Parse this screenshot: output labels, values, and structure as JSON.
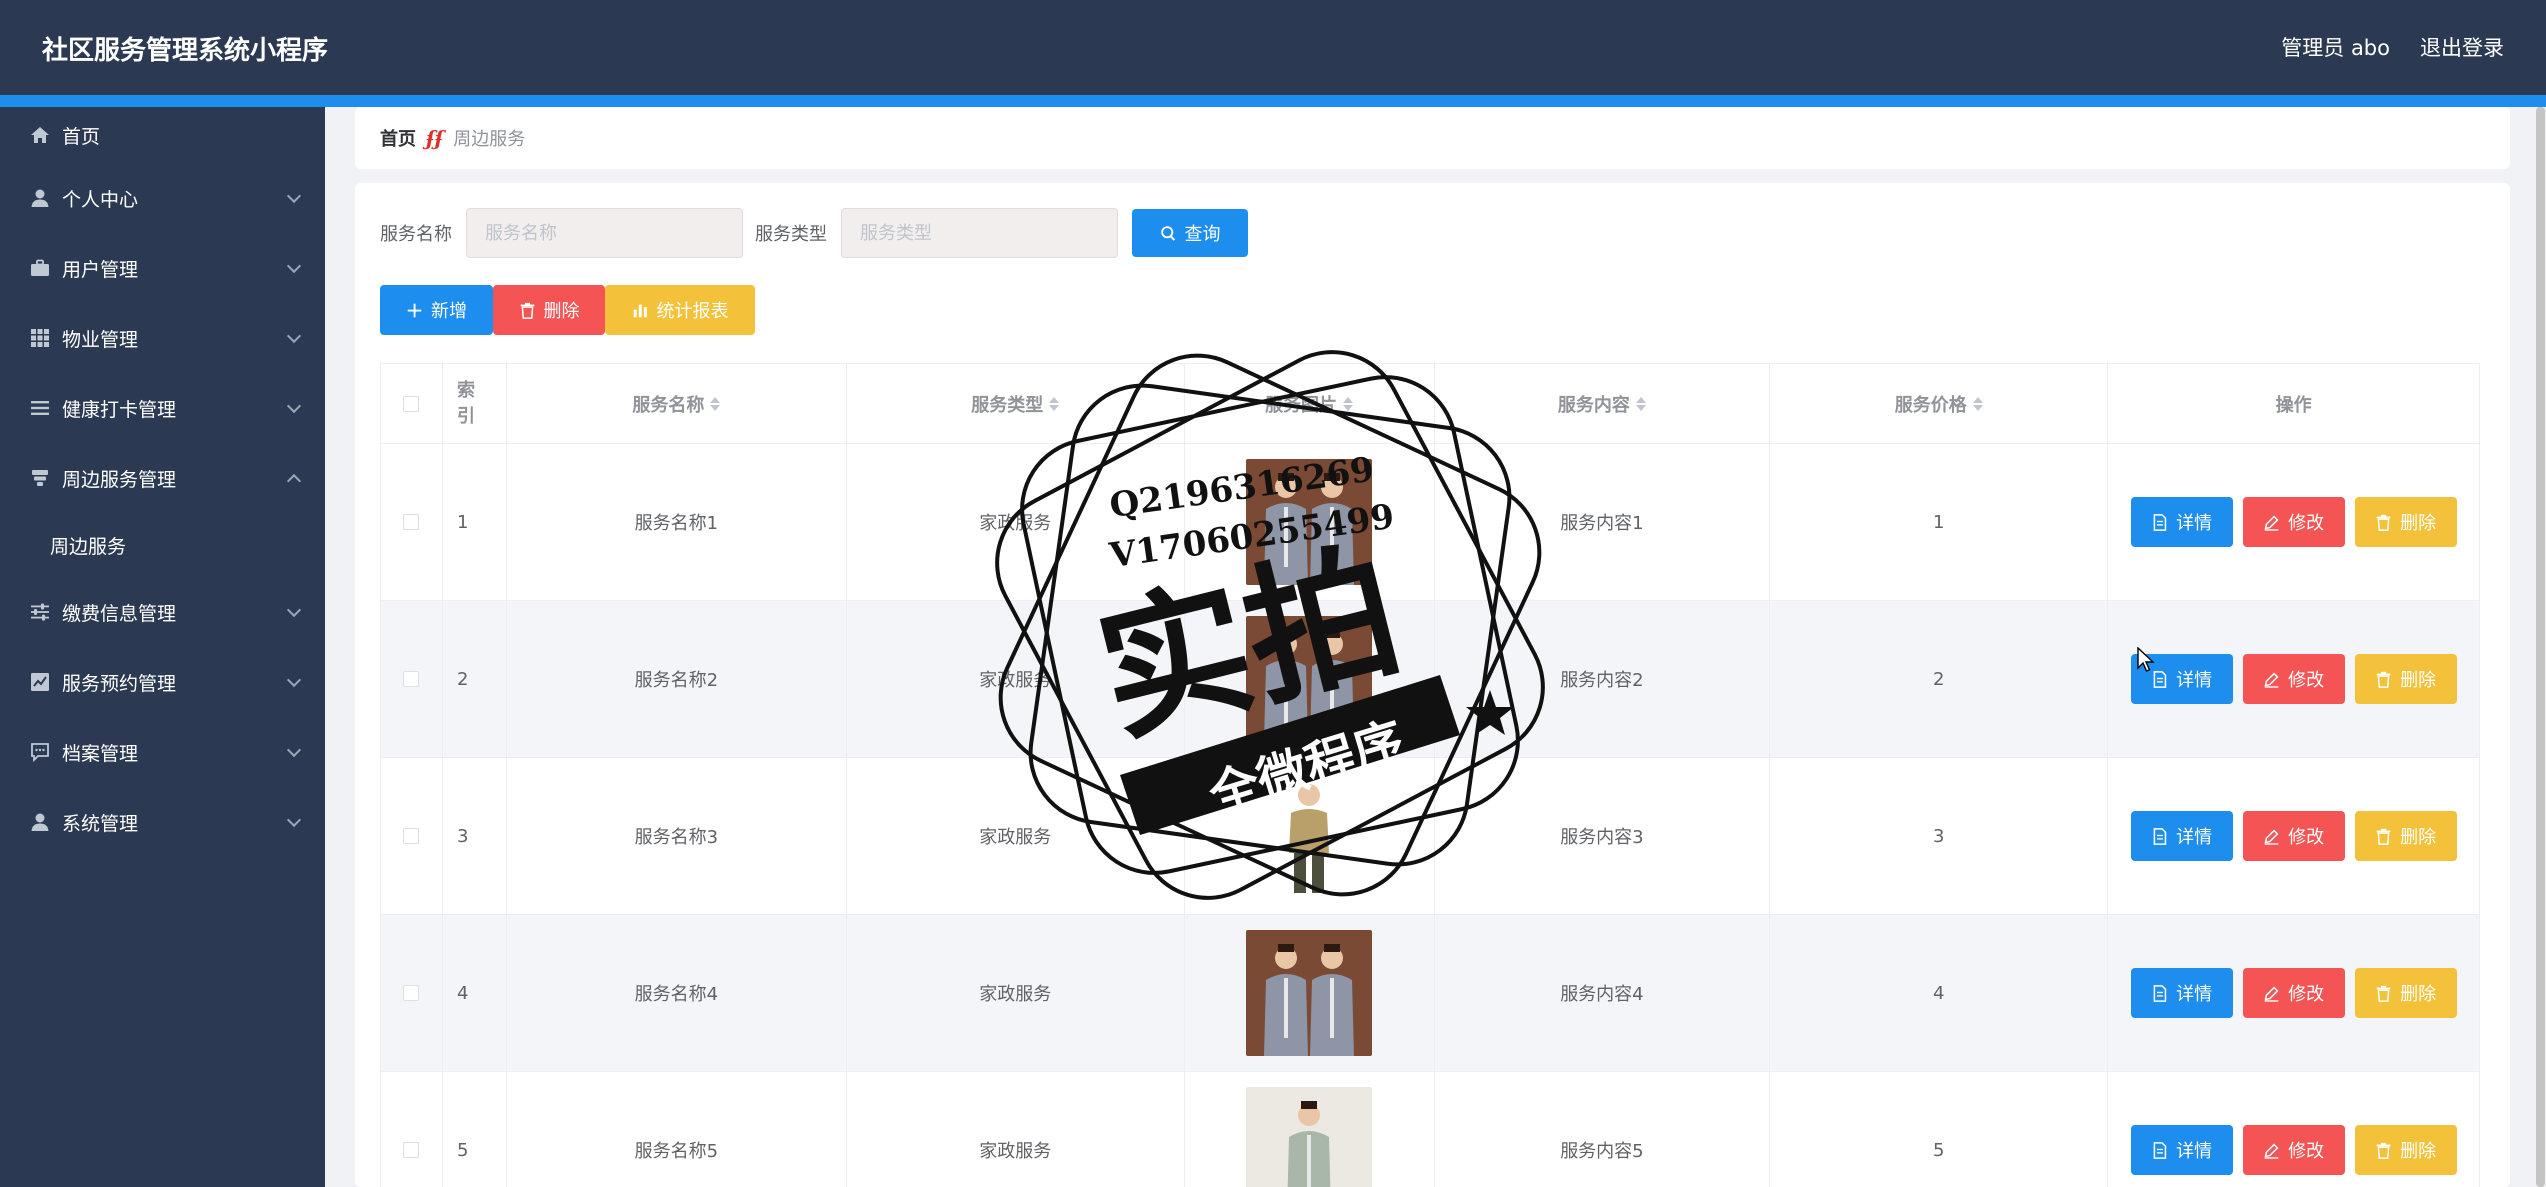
{
  "header": {
    "app_title": "社区服务管理系统小程序",
    "user_label": "管理员 abo",
    "logout_label": "退出登录"
  },
  "sidebar": {
    "items": [
      {
        "label": "首页",
        "icon": "home-icon",
        "expandable": false
      },
      {
        "label": "个人中心",
        "icon": "user-icon",
        "expandable": true
      },
      {
        "label": "用户管理",
        "icon": "briefcase-icon",
        "expandable": true
      },
      {
        "label": "物业管理",
        "icon": "grid-icon",
        "expandable": true
      },
      {
        "label": "健康打卡管理",
        "icon": "list-icon",
        "expandable": true
      },
      {
        "label": "周边服务管理",
        "icon": "stack-icon",
        "expandable": true,
        "expanded": true
      },
      {
        "label": "缴费信息管理",
        "icon": "sliders-icon",
        "expandable": true
      },
      {
        "label": "服务预约管理",
        "icon": "chart-box-icon",
        "expandable": true
      },
      {
        "label": "档案管理",
        "icon": "message-icon",
        "expandable": true
      },
      {
        "label": "系统管理",
        "icon": "user-icon",
        "expandable": true
      }
    ],
    "submenu": {
      "label": "周边服务"
    }
  },
  "breadcrumb": {
    "home": "首页",
    "separator": "ʄʄ",
    "current": "周边服务"
  },
  "search": {
    "name_label": "服务名称",
    "name_placeholder": "服务名称",
    "type_label": "服务类型",
    "type_placeholder": "服务类型",
    "query_label": "查询"
  },
  "actions": {
    "add_label": "新增",
    "delete_label": "删除",
    "report_label": "统计报表"
  },
  "table": {
    "headers": {
      "index_line1": "索",
      "index_line2": "引",
      "name": "服务名称",
      "type": "服务类型",
      "image": "服务图片",
      "content": "服务内容",
      "price": "服务价格",
      "operation": "操作"
    },
    "op_labels": {
      "detail": "详情",
      "edit": "修改",
      "delete": "删除"
    },
    "rows": [
      {
        "index": "1",
        "name": "服务名称1",
        "type": "家政服务",
        "content": "服务内容1",
        "price": "1"
      },
      {
        "index": "2",
        "name": "服务名称2",
        "type": "家政服务",
        "content": "服务内容2",
        "price": "2"
      },
      {
        "index": "3",
        "name": "服务名称3",
        "type": "家政服务",
        "content": "服务内容3",
        "price": "3"
      },
      {
        "index": "4",
        "name": "服务名称4",
        "type": "家政服务",
        "content": "服务内容4",
        "price": "4"
      },
      {
        "index": "5",
        "name": "服务名称5",
        "type": "家政服务",
        "content": "服务内容5",
        "price": "5"
      }
    ]
  },
  "watermark": {
    "line1": "Q2196316269",
    "line2": "V17060255499",
    "big_text": "实拍",
    "banner_text": "全微程序"
  },
  "colors": {
    "header_bg": "#2b3a52",
    "accent_blue": "#1e8eee",
    "danger_red": "#f45454",
    "warning_yellow": "#f4c23a"
  }
}
